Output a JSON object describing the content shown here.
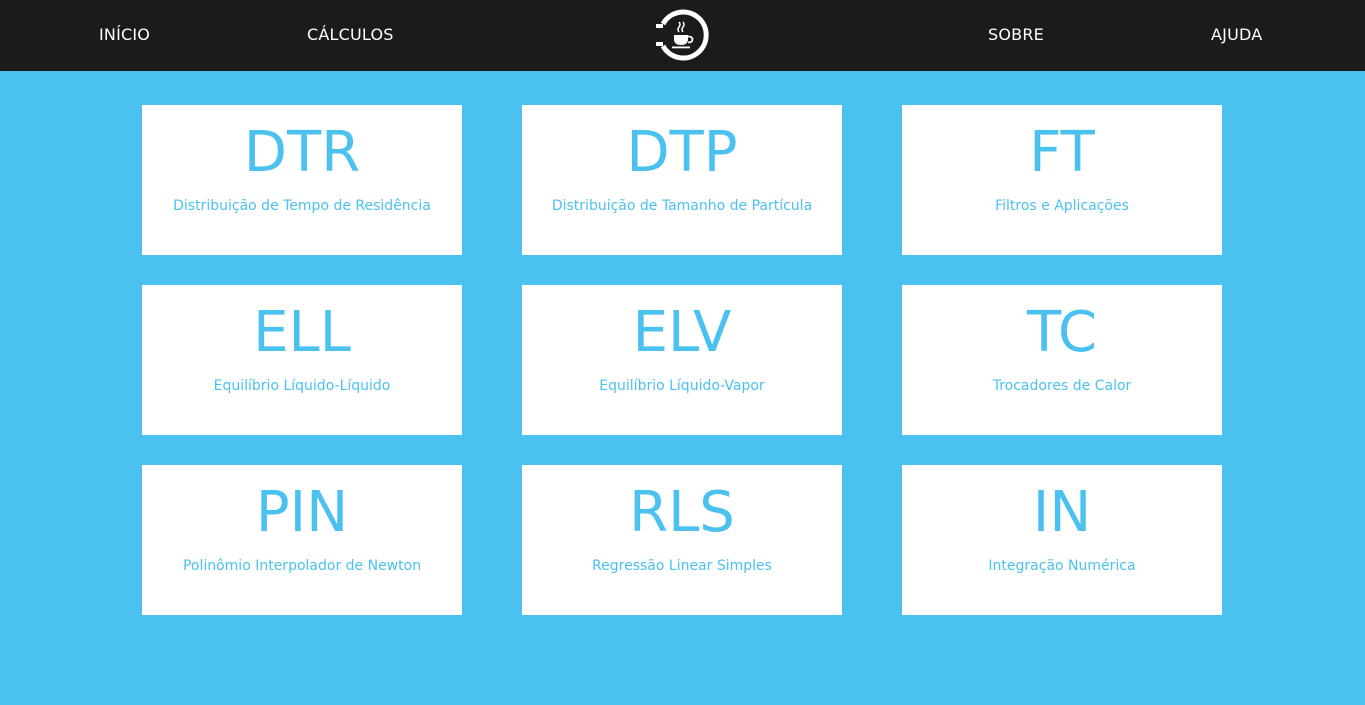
{
  "nav": {
    "left": [
      {
        "label": "INÍCIO"
      },
      {
        "label": "CÁLCULOS"
      }
    ],
    "right": [
      {
        "label": "SOBRE"
      },
      {
        "label": "AJUDA"
      }
    ],
    "logo_icon": "coffee-cup-ring-logo"
  },
  "colors": {
    "accent": "#4BC1EF",
    "navbar": "#1C1B1A",
    "card_bg": "#FFFFFF",
    "nav_text": "#FFFFFF"
  },
  "cards": [
    {
      "abbr": "DTR",
      "title": "Distribuição de Tempo de Residência"
    },
    {
      "abbr": "DTP",
      "title": "Distribuição de Tamanho de Partícula"
    },
    {
      "abbr": "FT",
      "title": "Filtros e Aplicações"
    },
    {
      "abbr": "ELL",
      "title": "Equilíbrio Líquido-Líquido"
    },
    {
      "abbr": "ELV",
      "title": "Equilíbrio Líquido-Vapor"
    },
    {
      "abbr": "TC",
      "title": "Trocadores de Calor"
    },
    {
      "abbr": "PIN",
      "title": "Polinômio Interpolador de Newton"
    },
    {
      "abbr": "RLS",
      "title": "Regressão Linear Simples"
    },
    {
      "abbr": "IN",
      "title": "Integração Numérica"
    }
  ]
}
